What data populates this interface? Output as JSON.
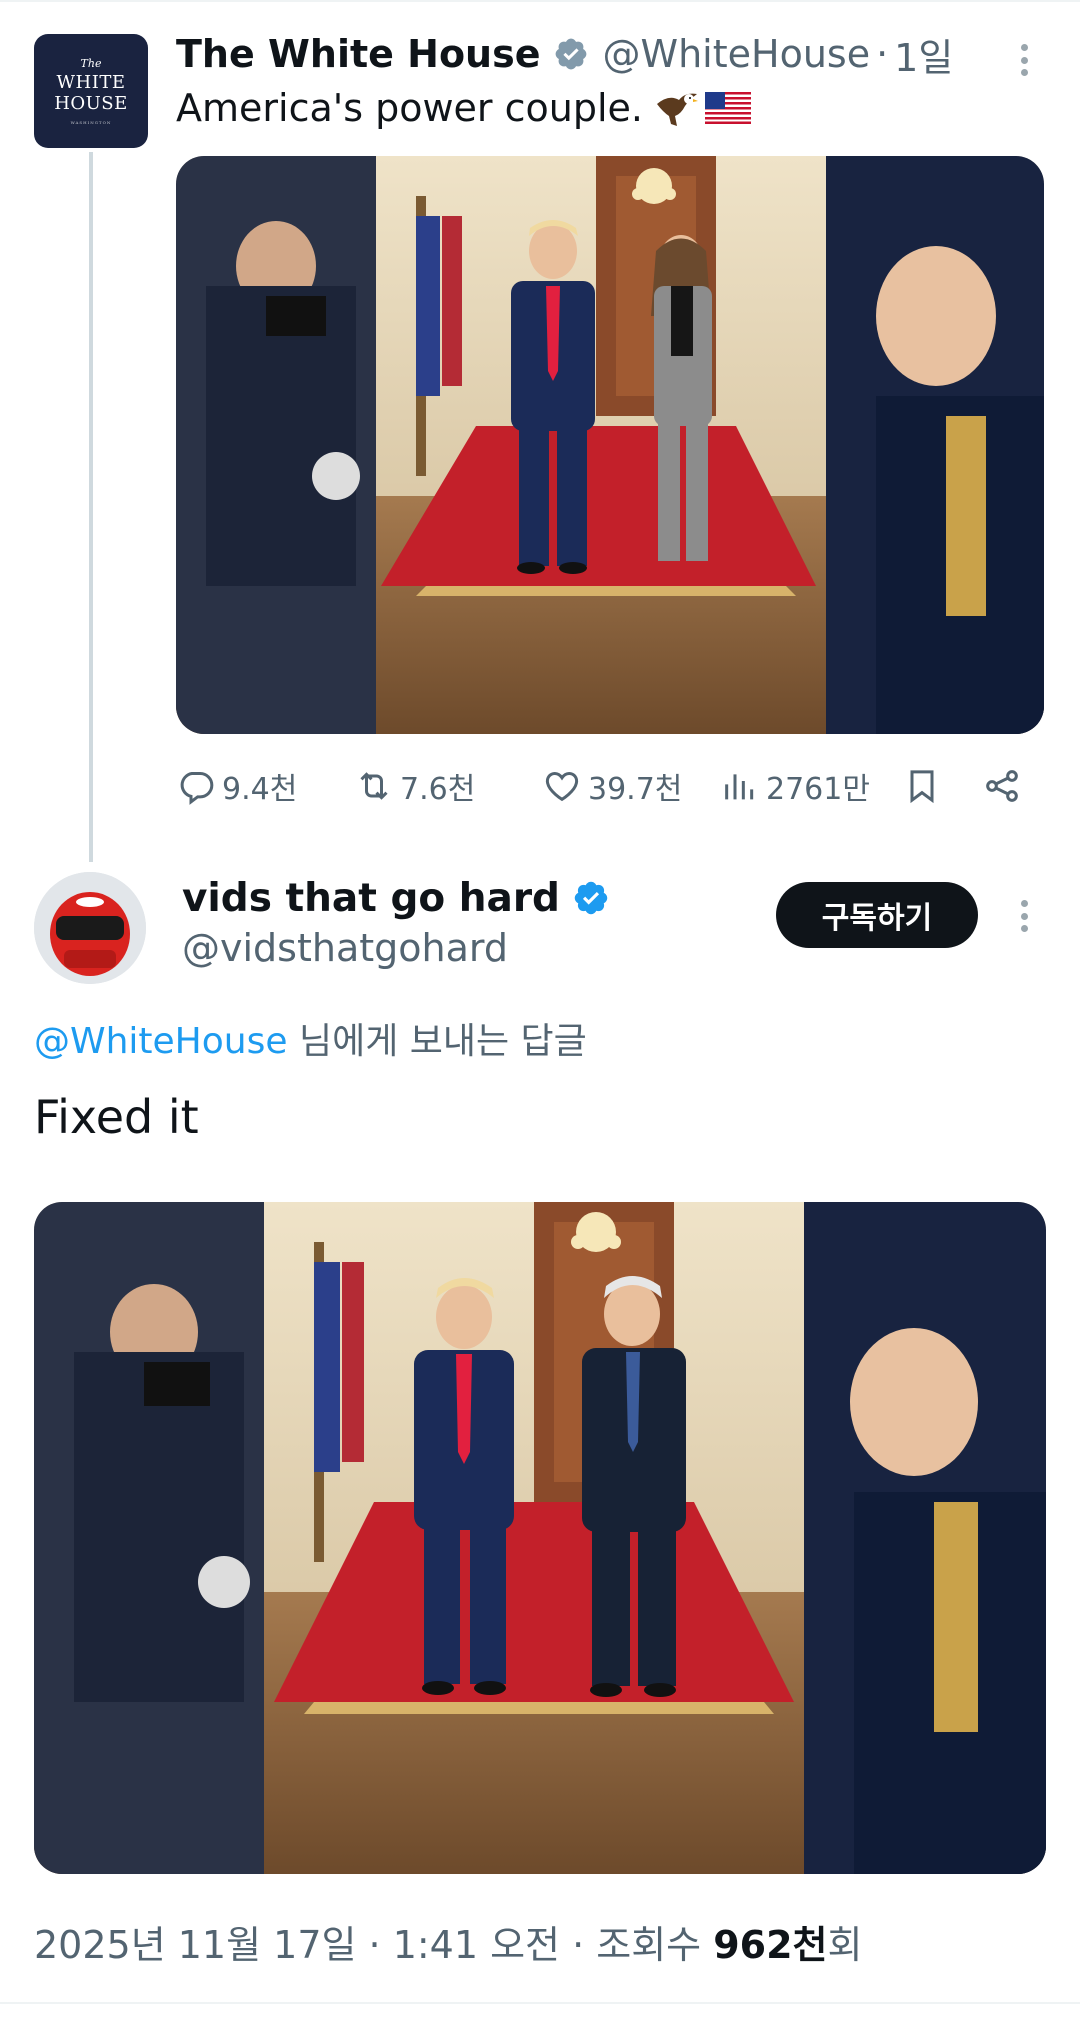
{
  "colors": {
    "accent": "#1d9bf0",
    "text": "#0f1419",
    "muted": "#536471",
    "carpet": "#c7262c"
  },
  "parent_tweet": {
    "avatar": {
      "line1": "The",
      "line2": "WHITE",
      "line3": "HOUSE",
      "line4": "WASHINGTON"
    },
    "name": "The White House",
    "handle": "@WhiteHouse",
    "separator": "·",
    "time": "1일",
    "text": "America's power couple.",
    "emoji": [
      "eagle-icon",
      "us-flag-icon"
    ],
    "stats": {
      "replies": "9.4천",
      "reposts": "7.6천",
      "likes": "39.7천",
      "views": "2761만"
    }
  },
  "reply": {
    "name": "vids that go hard",
    "handle": "@vidsthatgohard",
    "subscribe_label": "구독하기",
    "reply_to_mention": "@WhiteHouse",
    "reply_to_suffix": "님에게 보내는 답글",
    "text": "Fixed it",
    "meta_prefix": "2025년 11월 17일 · 1:41 오전 · 조회수 ",
    "views_value": "962천",
    "views_suffix": "회"
  }
}
